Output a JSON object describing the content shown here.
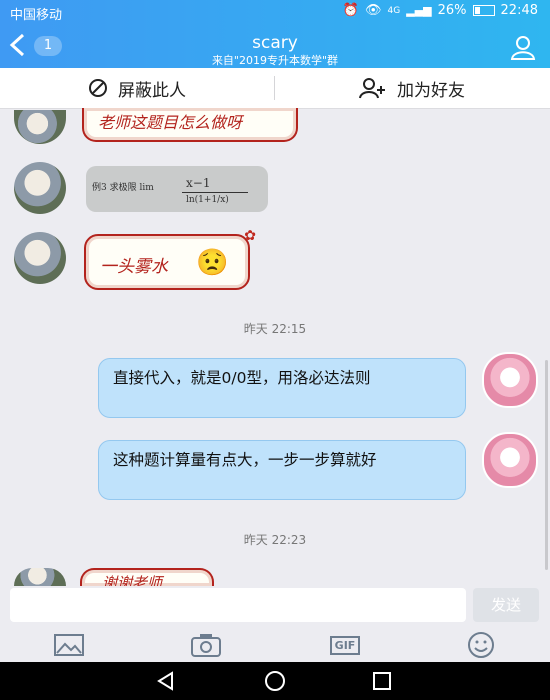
{
  "status": {
    "carrier": "中国移动",
    "network": "4G",
    "battery": "26%",
    "time": "22:48"
  },
  "header": {
    "back_count": "1",
    "title": "scary",
    "subtitle": "来自\"2019专升本数学\"群"
  },
  "actions": {
    "block_label": "屏蔽此人",
    "add_friend_label": "加为好友"
  },
  "messages": {
    "sticker1": "老师这题目怎么做呀",
    "image_caption": "例3 求极限 lim",
    "sticker2": "一头雾水",
    "time1": "昨天 22:15",
    "reply1": "直接代入，就是0/0型，用洛必达法则",
    "reply2": "这种题计算量有点大，一步一步算就好",
    "time2": "昨天 22:23",
    "sticker3": "谢谢老师"
  },
  "input": {
    "placeholder": "",
    "send_label": "发送"
  },
  "toolbar": {
    "gif_label": "GIF"
  }
}
